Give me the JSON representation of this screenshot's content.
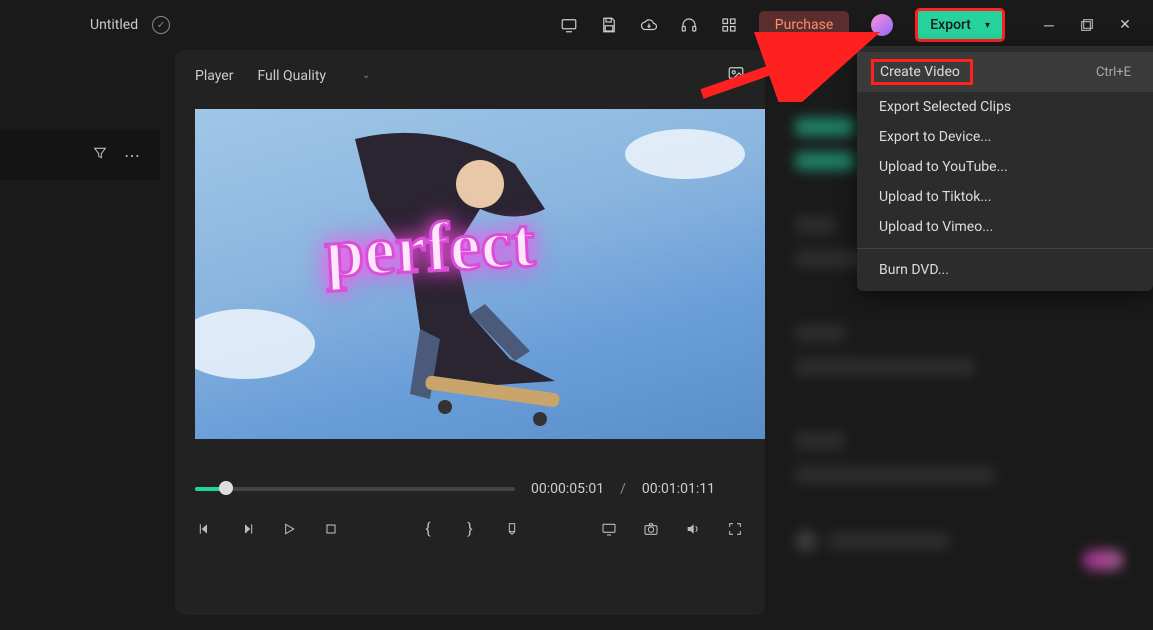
{
  "topbar": {
    "title": "Untitled",
    "purchase": "Purchase",
    "export": "Export"
  },
  "player": {
    "label": "Player",
    "quality": "Full Quality",
    "overlay_text": "perfect",
    "current_time": "00:00:05:01",
    "separator": "/",
    "total_time": "00:01:01:11"
  },
  "export_menu": {
    "items": [
      {
        "label": "Create Video",
        "shortcut": "Ctrl+E",
        "highlight": true
      },
      {
        "label": "Export Selected Clips"
      },
      {
        "label": "Export to Device..."
      },
      {
        "label": "Upload to YouTube..."
      },
      {
        "label": "Upload to Tiktok..."
      },
      {
        "label": "Upload to Vimeo..."
      },
      {
        "divider": true
      },
      {
        "label": "Burn DVD..."
      }
    ]
  }
}
